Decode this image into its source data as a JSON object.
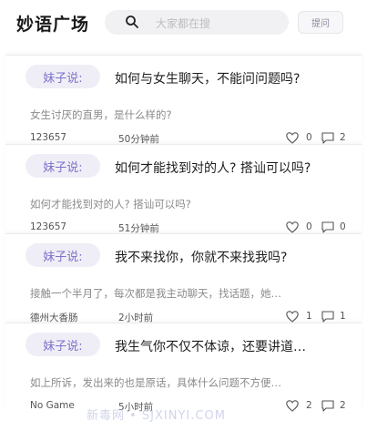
{
  "header": {
    "title": "妙语广场",
    "search_placeholder": "大家都在搜",
    "ask_label": "提问"
  },
  "posts": [
    {
      "tag": "妹子说:",
      "question": "如何与女生聊天，不能问问题吗?",
      "excerpt": "女生讨厌的直男，是什么样的?",
      "user": "123657",
      "time": "50分钟前",
      "likes": "0",
      "comments": "2"
    },
    {
      "tag": "妹子说:",
      "question": "如何才能找到对的人? 搭讪可以吗?",
      "excerpt": "如何才能找到对的人? 搭讪可以吗?",
      "user": "123657",
      "time": "51分钟前",
      "likes": "0",
      "comments": "0"
    },
    {
      "tag": "妹子说:",
      "question": "我不来找你，你就不来找我吗?",
      "excerpt": "接触一个半月了，每次都是我主动聊天，找话题，她…",
      "user": "德州大香肠",
      "time": "2小时前",
      "likes": "1",
      "comments": "1"
    },
    {
      "tag": "妹子说:",
      "question": "我生气你不仅不体谅，还要讲道…",
      "excerpt": "如上所诉，发出来的也是原话，具体什么问题不方便…",
      "user": "No Game",
      "time": "5小时前",
      "likes": "2",
      "comments": "2"
    }
  ],
  "watermark": "新毒网 • SJXINYI.COM",
  "colors": {
    "accent": "#7d72c9",
    "tag_bg": "#efeef6",
    "search_bg": "#f1f1f3"
  }
}
